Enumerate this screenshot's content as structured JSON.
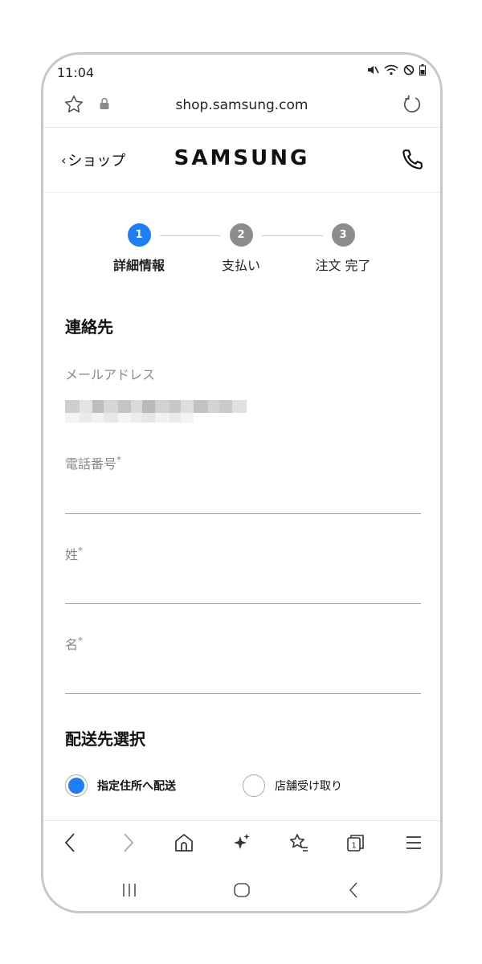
{
  "status": {
    "time": "11:04"
  },
  "browser": {
    "url": "shop.samsung.com"
  },
  "header": {
    "back_label": "ショップ",
    "logo": "SAMSUNG"
  },
  "steps": [
    {
      "number": "1",
      "label": "詳細情報",
      "active": true
    },
    {
      "number": "2",
      "label": "支払い",
      "active": false
    },
    {
      "number": "3",
      "label": "注文 完了",
      "active": false
    }
  ],
  "colors": {
    "accent": "#1f7ef5",
    "inactive_step": "#8c8c8c"
  },
  "contact": {
    "title": "連絡先",
    "email_label": "メールアドレス",
    "phone_label": "電話番号",
    "lastname_label": "姓",
    "firstname_label": "名",
    "required_mark": "*"
  },
  "delivery": {
    "title": "配送先選択",
    "option_home": "指定住所へ配送",
    "option_store": "店舗受け取り"
  }
}
